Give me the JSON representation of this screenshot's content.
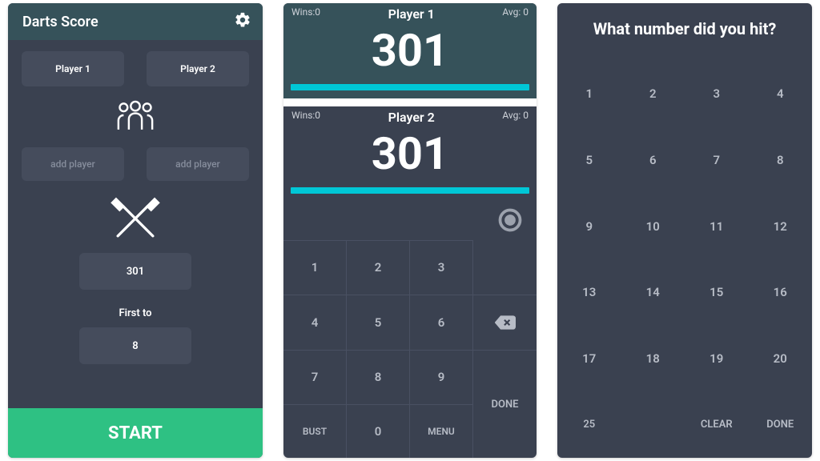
{
  "panel1": {
    "title": "Darts Score",
    "players": [
      "Player 1",
      "Player 2"
    ],
    "add_label": "add player",
    "game_type": "301",
    "first_to_label": "First to",
    "first_to_value": "8",
    "start_label": "START"
  },
  "panel2": {
    "scores": [
      {
        "name": "Player 1",
        "wins_label": "Wins:0",
        "avg_label": "Avg: 0",
        "score": "301",
        "active": true
      },
      {
        "name": "Player 2",
        "wins_label": "Wins:0",
        "avg_label": "Avg: 0",
        "score": "301",
        "active": false
      }
    ],
    "keypad": {
      "k1": "1",
      "k2": "2",
      "k3": "3",
      "k4": "4",
      "k5": "5",
      "k6": "6",
      "k7": "7",
      "k8": "8",
      "k9": "9",
      "k0": "0",
      "bust": "BUST",
      "menu": "MENU",
      "done": "DONE"
    }
  },
  "panel3": {
    "title": "What number did you hit?",
    "grid": [
      "1",
      "2",
      "3",
      "4",
      "5",
      "6",
      "7",
      "8",
      "9",
      "10",
      "11",
      "12",
      "13",
      "14",
      "15",
      "16",
      "17",
      "18",
      "19",
      "20"
    ],
    "last": {
      "n25": "25",
      "clear": "CLEAR",
      "done": "DONE"
    }
  }
}
